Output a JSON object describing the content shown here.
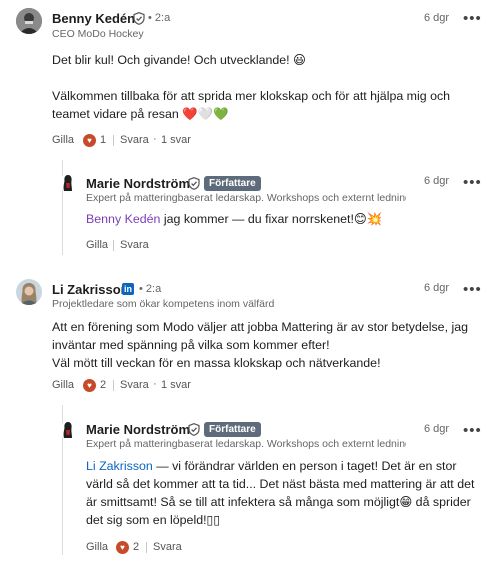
{
  "comments": [
    {
      "author": "Benny Kedén",
      "degree": "• 2:a",
      "headline": "CEO MoDo Hockey",
      "time": "6 dgr",
      "body": [
        "Det blir kul! Och givande! Och utvecklande! 😃",
        "Välkommen tillbaka för att sprida mer klokskap och för att hjälpa mig och",
        "teamet vidare på resan ❤️🤍💚"
      ],
      "like_label": "Gilla",
      "reaction_count": "1",
      "reply_label": "Svara",
      "replies_count": "1 svar"
    },
    {
      "author": "Marie Nordström",
      "badge": "Författare",
      "headline": "Expert på matteringbaserat ledarskap. Workshops och externt ledning...",
      "time": "6 dgr",
      "mention": "Benny Kedén",
      "body_rest": " jag kommer — du fixar norrskenet!😊💥",
      "like_label": "Gilla",
      "reply_label": "Svara"
    },
    {
      "author": "Li Zakrisson",
      "degree": "• 2:a",
      "headline": "Projektledare som ökar kompetens inom välfärd",
      "time": "6 dgr",
      "body": [
        "Att en förening som Modo väljer att jobba Mattering är av stor betydelse, jag",
        "inväntar med spänning på vilka som kommer efter!",
        "Väl mött till veckan för en massa klokskap och nätverkande!"
      ],
      "like_label": "Gilla",
      "reaction_count": "2",
      "reply_label": "Svara",
      "replies_count": "1 svar"
    },
    {
      "author": "Marie Nordström",
      "badge": "Författare",
      "headline": "Expert på matteringbaserat ledarskap. Workshops och externt ledning...",
      "time": "6 dgr",
      "mention": "Li Zakrisson",
      "body_first": " — vi förändrar världen en person i taget! Det är en stor",
      "body": [
        "värld så det kommer att ta tid... Det näst bästa med mattering är att det",
        "är smittsamt! Så se till att infektera så många som möjligt😁 då sprider",
        "det sig som en löpeld!▯▯"
      ],
      "like_label": "Gilla",
      "reaction_count": "2",
      "reply_label": "Svara"
    }
  ],
  "icons": {
    "verified": "shield-check-icon",
    "linkedin": "linkedin-premium-icon",
    "more": "more-horizontal-icon",
    "reaction": "heart-reaction-icon"
  },
  "colors": {
    "mention_purple": "#7a3fb8",
    "mention_blue": "#0a66c2",
    "author_badge": "#5d6b7a",
    "reaction": "#c64b2a"
  }
}
